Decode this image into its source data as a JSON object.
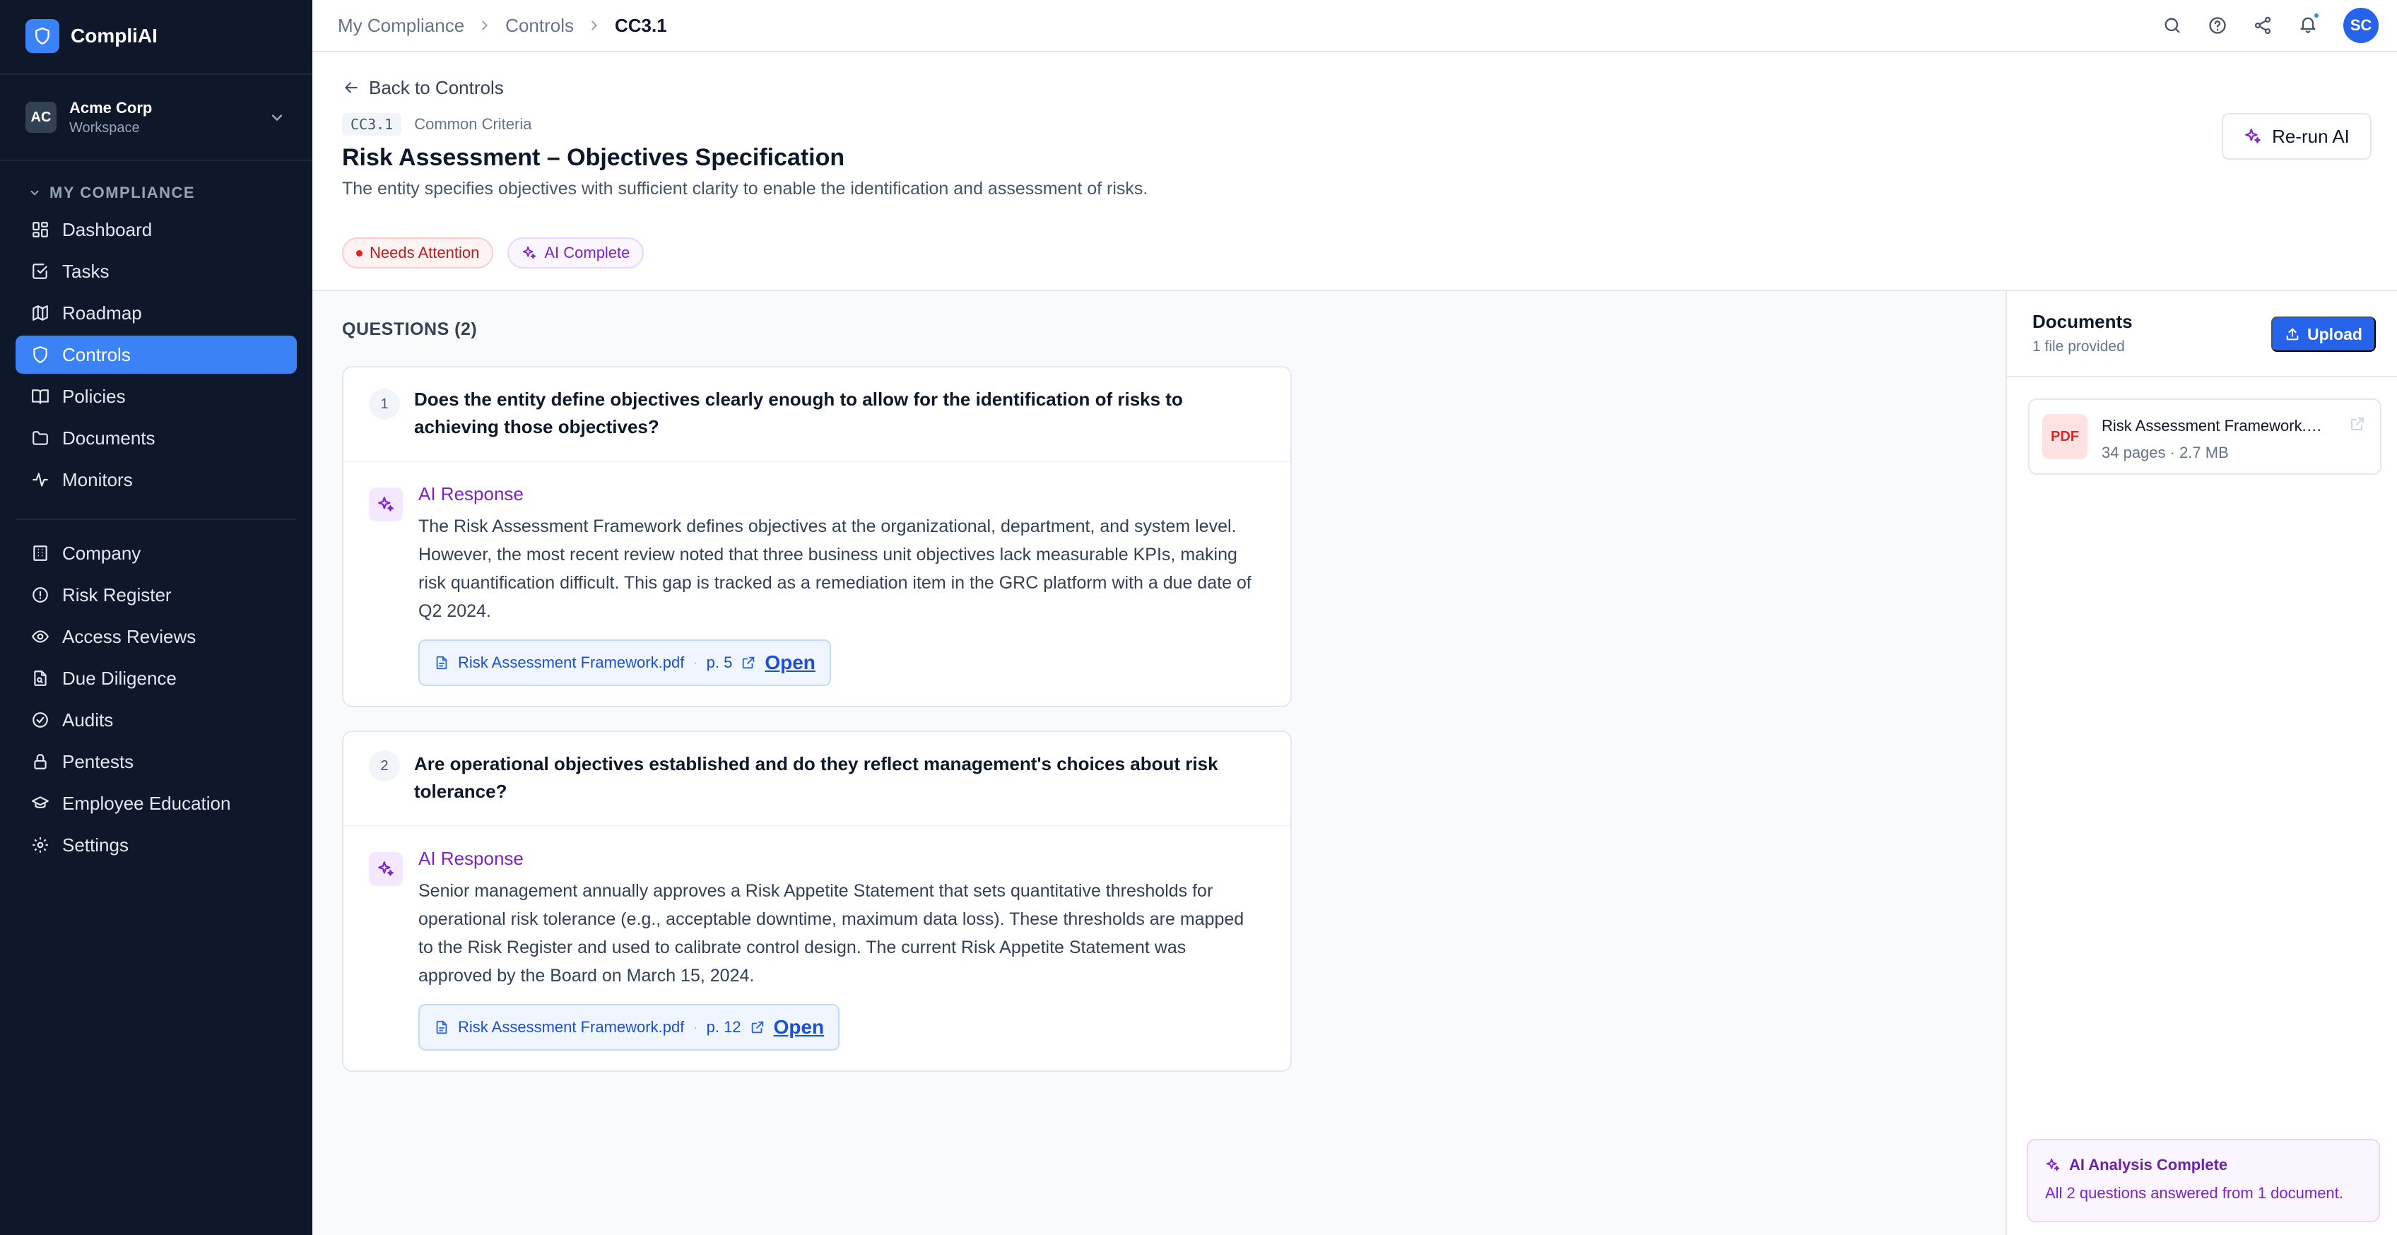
{
  "brand": {
    "name": "CompliAI"
  },
  "workspace": {
    "initials": "AC",
    "name": "Acme Corp",
    "sub": "Workspace"
  },
  "sidebar": {
    "section_label": "MY COMPLIANCE",
    "group1": [
      {
        "label": "Dashboard",
        "icon": "dashboard-icon"
      },
      {
        "label": "Tasks",
        "icon": "tasks-icon"
      },
      {
        "label": "Roadmap",
        "icon": "roadmap-icon"
      },
      {
        "label": "Controls",
        "icon": "shield-icon",
        "active": true
      },
      {
        "label": "Policies",
        "icon": "book-icon"
      },
      {
        "label": "Documents",
        "icon": "folder-icon"
      },
      {
        "label": "Monitors",
        "icon": "activity-icon"
      }
    ],
    "group2": [
      {
        "label": "Company",
        "icon": "building-icon"
      },
      {
        "label": "Risk Register",
        "icon": "alert-circle-icon"
      },
      {
        "label": "Access Reviews",
        "icon": "eye-icon"
      },
      {
        "label": "Due Diligence",
        "icon": "file-search-icon"
      },
      {
        "label": "Audits",
        "icon": "check-circle-icon"
      },
      {
        "label": "Pentests",
        "icon": "lock-icon"
      },
      {
        "label": "Employee Education",
        "icon": "graduation-cap-icon"
      },
      {
        "label": "Settings",
        "icon": "gear-icon"
      }
    ]
  },
  "breadcrumb": [
    "My Compliance",
    "Controls",
    "CC3.1"
  ],
  "user": {
    "initials": "SC"
  },
  "header": {
    "back_label": "Back to Controls",
    "code": "CC3.1",
    "category": "Common Criteria",
    "title": "Risk Assessment – Objectives Specification",
    "description": "The entity specifies objectives with sufficient clarity to enable the identification and assessment of risks.",
    "badge_attention": "Needs Attention",
    "badge_ai": "AI Complete",
    "rerun_label": "Re-run AI"
  },
  "questions": {
    "label": "QUESTIONS (2)",
    "items": [
      {
        "num": "1",
        "text": "Does the entity define objectives clearly enough to allow for the identification of risks to achieving those objectives?",
        "ai_title": "AI Response",
        "answer": "The Risk Assessment Framework defines objectives at the organizational, department, and system level. However, the most recent review noted that three business unit objectives lack measurable KPIs, making risk quantification difficult. This gap is tracked as a remediation item in the GRC platform with a due date of Q2 2024.",
        "cite_file": "Risk Assessment Framework.pdf",
        "cite_sep": "·",
        "cite_page": "p. 5",
        "open_label": "Open"
      },
      {
        "num": "2",
        "text": "Are operational objectives established and do they reflect management's choices about risk tolerance?",
        "ai_title": "AI Response",
        "answer": "Senior management annually approves a Risk Appetite Statement that sets quantitative thresholds for operational risk tolerance (e.g., acceptable downtime, maximum data loss). These thresholds are mapped to the Risk Register and used to calibrate control design. The current Risk Appetite Statement was approved by the Board on March 15, 2024.",
        "cite_file": "Risk Assessment Framework.pdf",
        "cite_sep": "·",
        "cite_page": "p. 12",
        "open_label": "Open"
      }
    ]
  },
  "documents": {
    "title": "Documents",
    "sub": "1 file provided",
    "upload_label": "Upload",
    "file": {
      "type": "PDF",
      "name": "Risk Assessment Framework.pdf",
      "meta": "34 pages · 2.7 MB"
    }
  },
  "analysis": {
    "title": "AI Analysis Complete",
    "text": "All 2 questions answered from 1 document."
  },
  "colors": {
    "accent": "#3b82f6",
    "sidebar_bg": "#0f172a",
    "ai_purple": "#7e22ce",
    "danger": "#dc2626"
  }
}
